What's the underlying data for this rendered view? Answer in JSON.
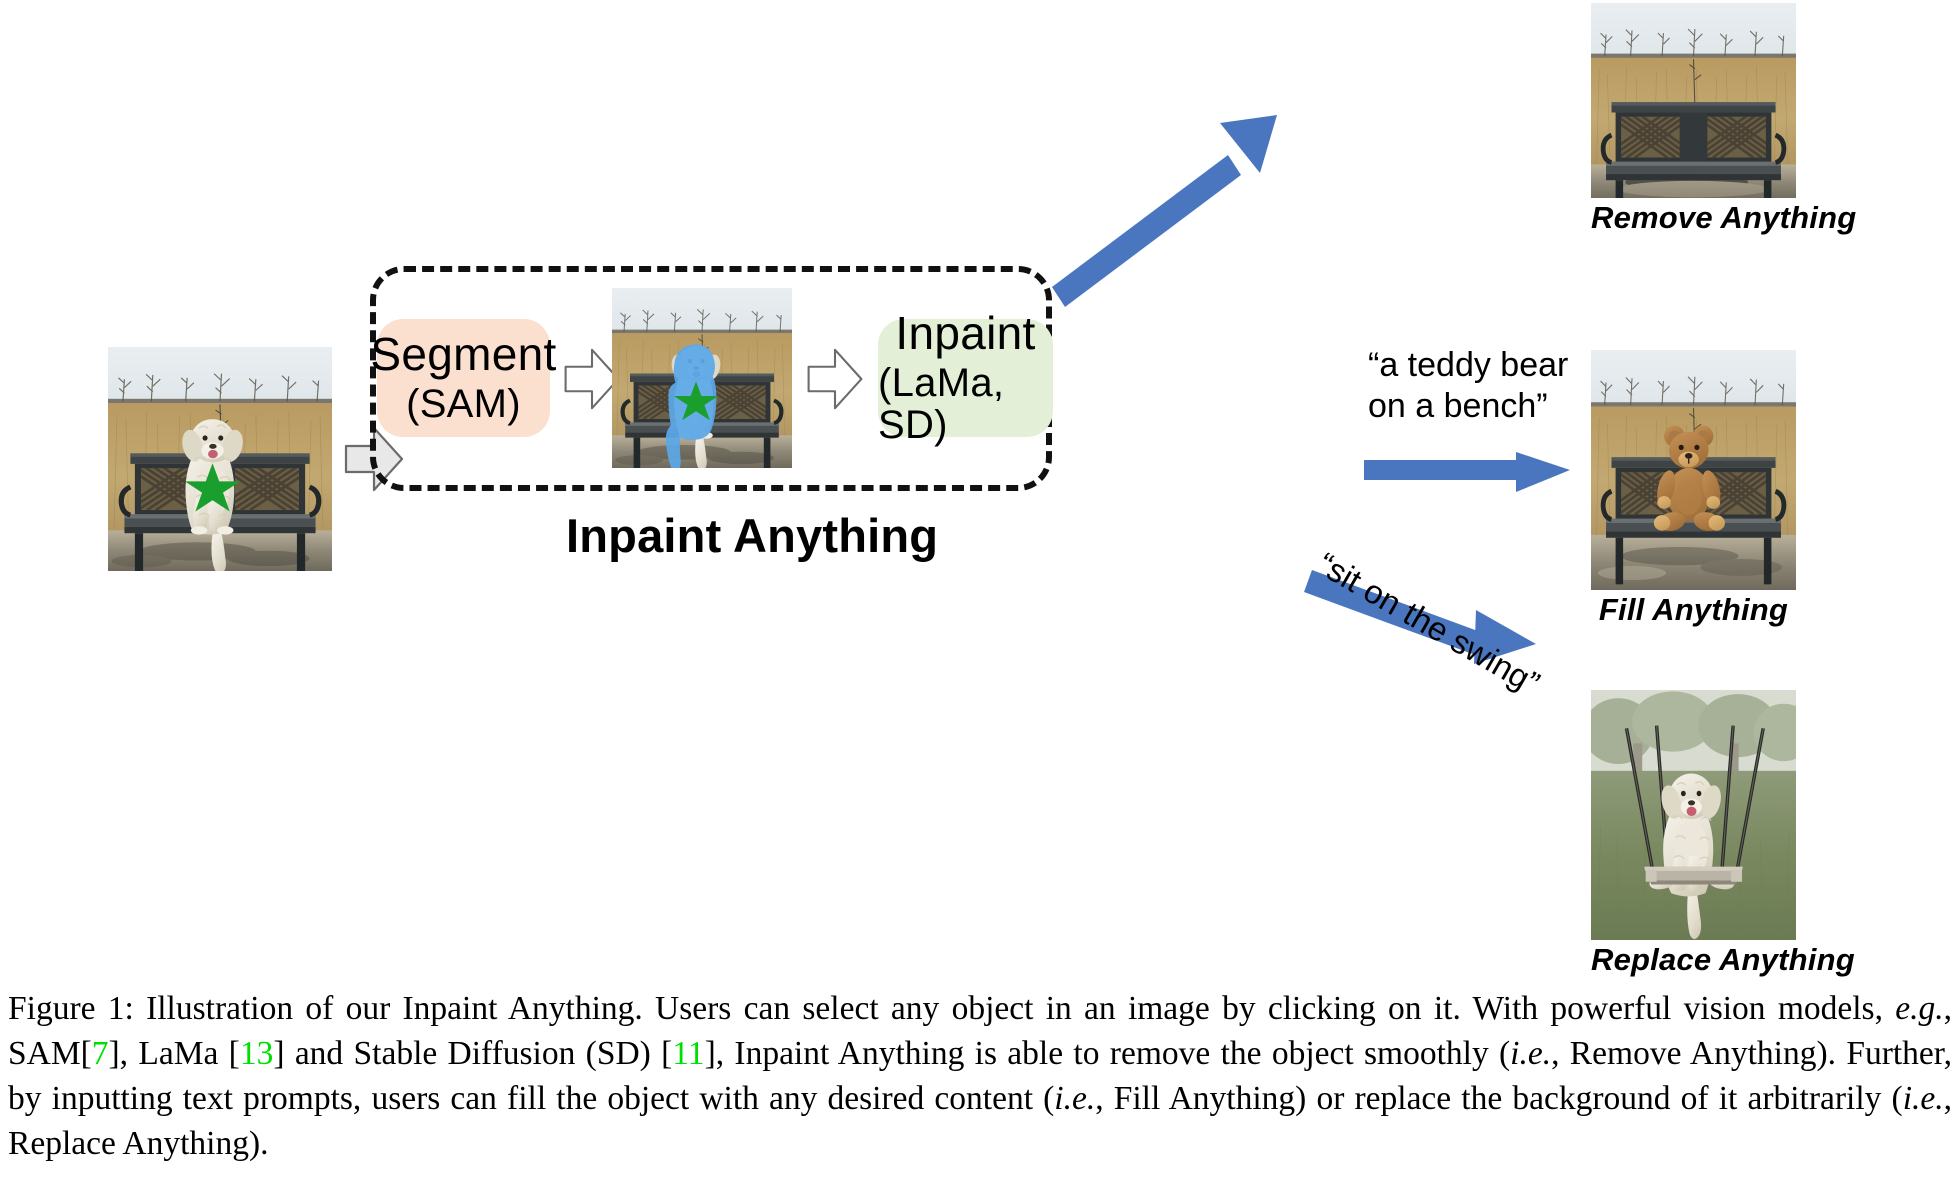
{
  "figure": {
    "pipeline_title": "Inpaint Anything",
    "stages": [
      {
        "name": "segment",
        "line1": "Segment",
        "line2": "(SAM)",
        "bg": "#fbe0d0"
      },
      {
        "name": "inpaint",
        "line1": "Inpaint",
        "line2": "(LaMa, SD)",
        "bg": "#e3efd6"
      }
    ],
    "prompts": {
      "fill": {
        "line1": "“a teddy bear",
        "line2": "on a bench”"
      },
      "replace": "“sit on the swing”"
    },
    "outputs": [
      {
        "name": "remove",
        "label": "Remove Anything",
        "alt": "Empty wooden bench in a dry grass field"
      },
      {
        "name": "fill",
        "label": "Fill Anything",
        "alt": "Brown teddy bear sitting on the bench"
      },
      {
        "name": "replace",
        "label": "Replace Anything",
        "alt": "White curly dog sitting on a park swing"
      }
    ],
    "input_image": {
      "name": "input-photo",
      "alt": "White curly dog sitting on a bench with a green star click marker"
    },
    "masked_image": {
      "name": "masked-photo",
      "alt": "Same dog photo with the dog segmented in blue mask and a green star"
    },
    "colors": {
      "segment_box": "#fbe0d0",
      "inpaint_box": "#e3efd6",
      "blue_arrow": "#4a76bf",
      "grey_arrow_fill": "#e8e8e8",
      "grey_arrow_stroke": "#6b6b6b",
      "star": "#1a9e2e",
      "mask": "#5ba8e8",
      "dashed_border": "#111111",
      "citation": "#00e000"
    }
  },
  "caption": {
    "label": "Figure 1:",
    "parts": [
      {
        "t": " Illustration of our Inpaint Anything. Users can select any object in an image by clicking on it. With powerful vision models, "
      },
      {
        "t": "e.g.",
        "style": "italic"
      },
      {
        "t": ", SAM["
      },
      {
        "t": "7",
        "style": "cite"
      },
      {
        "t": "], LaMa ["
      },
      {
        "t": "13",
        "style": "cite"
      },
      {
        "t": "] and Stable Diffusion (SD) ["
      },
      {
        "t": "11",
        "style": "cite"
      },
      {
        "t": "], Inpaint Anything is able to remove the object smoothly ("
      },
      {
        "t": "i.e.",
        "style": "italic"
      },
      {
        "t": ", Remove Anything).  Further, by inputting text prompts, users can fill the object with any desired content ("
      },
      {
        "t": "i.e.",
        "style": "italic"
      },
      {
        "t": ", Fill Anything) or replace the background of it arbitrarily ("
      },
      {
        "t": "i.e.",
        "style": "italic"
      },
      {
        "t": ", Replace Anything)."
      }
    ]
  }
}
